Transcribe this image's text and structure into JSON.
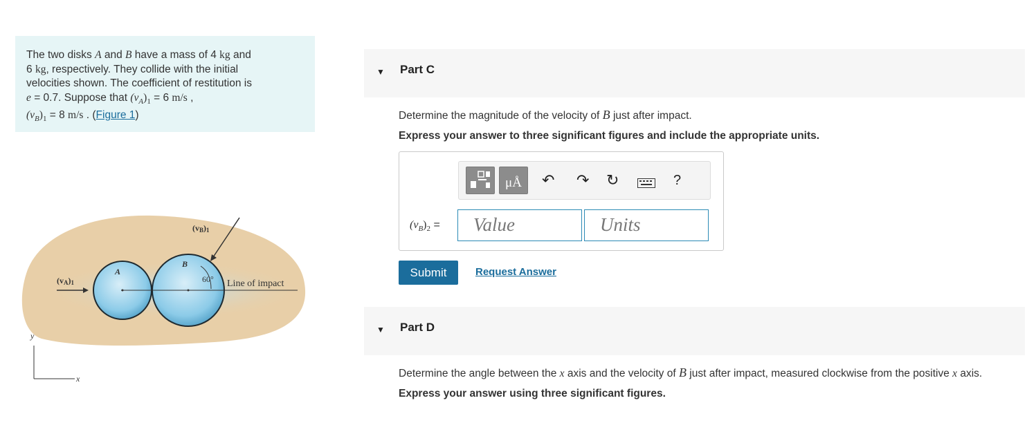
{
  "problem": {
    "line1a": "The two disks ",
    "disk_a": "A",
    "line1b": " and ",
    "disk_b": "B",
    "line1c": " have a mass of 4 ",
    "unit_kg1": "kg",
    "line1d": " and",
    "line2a": "6 ",
    "unit_kg2": "kg",
    "line2b": ", respectively. They collide with the initial",
    "line3": "velocities shown. The coefficient of restitution is",
    "line4a": "e",
    "line4b": " = 0.7. Suppose that ",
    "va_sym": "(v",
    "va_sub": "A",
    "va_close": ")",
    "va_sub1": "1",
    "line4c": " = 6 ",
    "unit_ms1": "m/s",
    "line4d": " ,",
    "vb_sym": "(v",
    "vb_sub": "B",
    "vb_close": ")",
    "vb_sub1": "1",
    "line5a": " = 8 ",
    "unit_ms2": "m/s",
    "line5b": " . (",
    "figure_link": "Figure 1",
    "line5c": ")"
  },
  "figure": {
    "label_va1": "(v",
    "label_va1_sub": "A",
    "label_va1_end": ")",
    "label_va1_n": "1",
    "label_vb1": "(v",
    "label_vb1_sub": "B",
    "label_vb1_end": ")",
    "label_vb1_n": "1",
    "label_a": "A",
    "label_b": "B",
    "angle": "60°",
    "line_of_impact": "Line of impact",
    "axis_y": "y",
    "axis_x": "x"
  },
  "part_c": {
    "title": "Part C",
    "question_a": "Determine the magnitude of the velocity of ",
    "question_var": "B",
    "question_b": " just after impact.",
    "instruction": "Express your answer to three significant figures and include the appropriate units.",
    "answer_label_a": "(v",
    "answer_label_sub": "B",
    "answer_label_b": ")",
    "answer_label_n": "2",
    "answer_label_eq": " =",
    "value_placeholder": "Value",
    "units_placeholder": "Units",
    "toolbar": {
      "units_btn": "μÅ",
      "help": "?"
    },
    "submit_label": "Submit",
    "request_label": "Request Answer"
  },
  "part_d": {
    "title": "Part D",
    "question_a": "Determine the angle between the ",
    "var_x1": "x",
    "question_b": " axis and the velocity of ",
    "var_b": "B",
    "question_c": " just after impact, measured clockwise from the positive ",
    "var_x2": "x",
    "question_d": " axis.",
    "instruction": "Express your answer using three significant figures."
  },
  "colors": {
    "accent": "#1b6d9c",
    "panel_bg": "#e6f5f6",
    "figure_bg": "#e8cfa8",
    "disk": "#7dc3e3"
  }
}
